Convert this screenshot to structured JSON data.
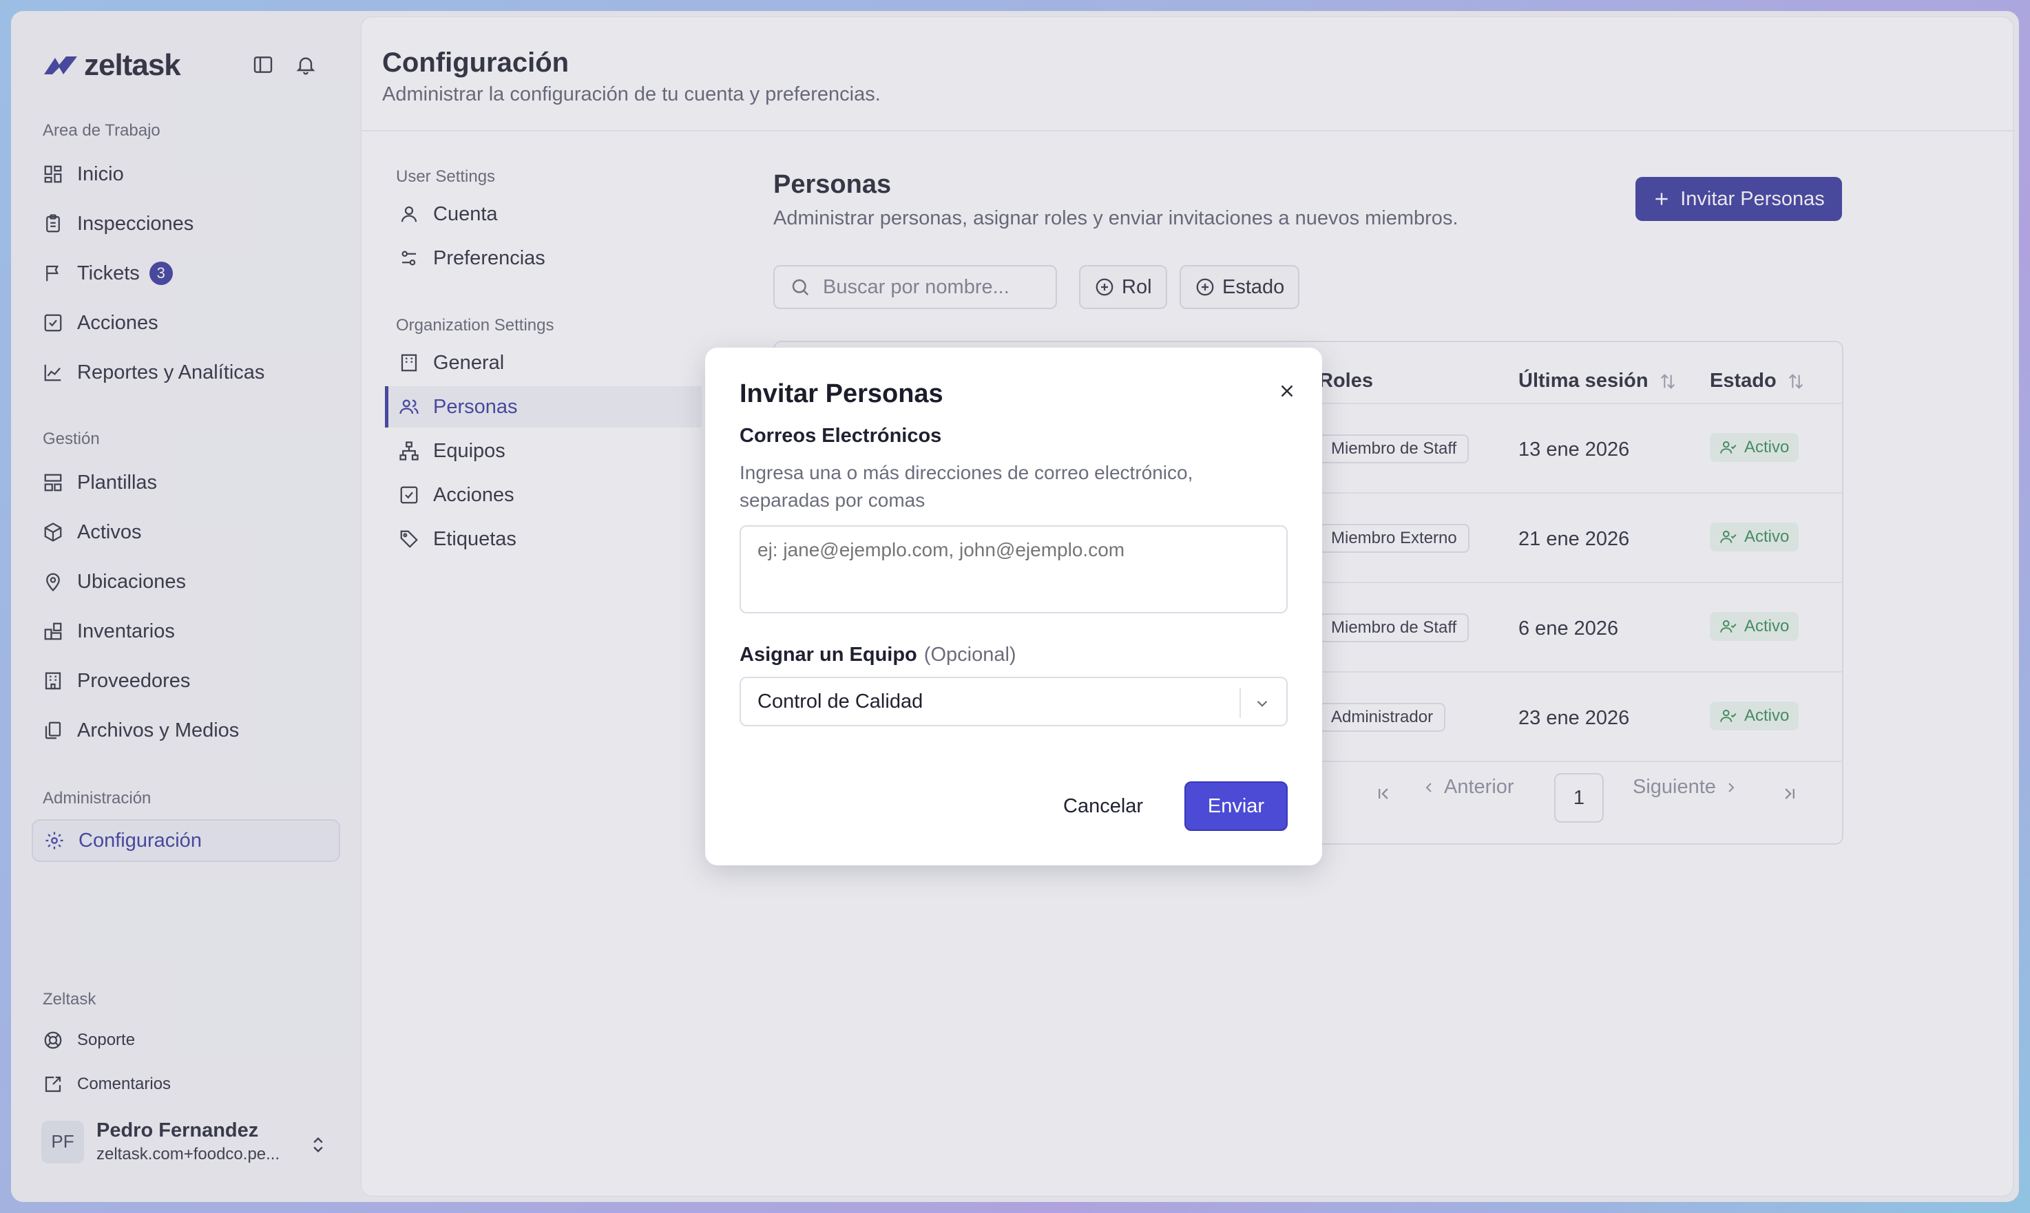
{
  "brand": {
    "name": "zeltask",
    "accent": "#33339a"
  },
  "sidebar": {
    "workspace_label": "Area de Trabajo",
    "workspace_items": [
      {
        "label": "Inicio",
        "icon": "grid-icon"
      },
      {
        "label": "Inspecciones",
        "icon": "clipboard-icon"
      },
      {
        "label": "Tickets",
        "icon": "flag-icon",
        "badge": "3"
      },
      {
        "label": "Acciones",
        "icon": "checkbox-icon"
      },
      {
        "label": "Reportes y Analíticas",
        "icon": "chart-icon"
      }
    ],
    "management_label": "Gestión",
    "management_items": [
      {
        "label": "Plantillas",
        "icon": "template-icon"
      },
      {
        "label": "Activos",
        "icon": "cube-icon"
      },
      {
        "label": "Ubicaciones",
        "icon": "map-pin-icon"
      },
      {
        "label": "Inventarios",
        "icon": "blocks-icon"
      },
      {
        "label": "Proveedores",
        "icon": "building-icon"
      },
      {
        "label": "Archivos y Medios",
        "icon": "files-icon"
      }
    ],
    "admin_label": "Administración",
    "admin_items": [
      {
        "label": "Configuración",
        "icon": "gear-icon",
        "active": true
      }
    ],
    "footer_label": "Zeltask",
    "footer_items": [
      {
        "label": "Soporte",
        "icon": "lifebuoy-icon"
      },
      {
        "label": "Comentarios",
        "icon": "feedback-icon"
      }
    ],
    "user": {
      "initials": "PF",
      "name": "Pedro Fernandez",
      "email": "zeltask.com+foodco.pe..."
    }
  },
  "header": {
    "title": "Configuración",
    "subtitle": "Administrar la configuración de tu cuenta y preferencias."
  },
  "settings_nav": {
    "user_label": "User Settings",
    "user_items": [
      {
        "label": "Cuenta",
        "icon": "user-icon"
      },
      {
        "label": "Preferencias",
        "icon": "sliders-icon"
      }
    ],
    "org_label": "Organization Settings",
    "org_items": [
      {
        "label": "General",
        "icon": "building-icon"
      },
      {
        "label": "Personas",
        "icon": "users-icon",
        "active": true
      },
      {
        "label": "Equipos",
        "icon": "org-chart-icon"
      },
      {
        "label": "Acciones",
        "icon": "checkbox-icon"
      },
      {
        "label": "Etiquetas",
        "icon": "tag-icon"
      }
    ]
  },
  "people": {
    "title": "Personas",
    "subtitle": "Administrar personas, asignar roles y enviar invitaciones a nuevos miembros.",
    "invite_label": "Invitar Personas",
    "search_placeholder": "Buscar por nombre...",
    "filters": [
      "Rol",
      "Estado"
    ],
    "columns": {
      "roles": "Roles",
      "last_session": "Última sesión",
      "status": "Estado"
    },
    "rows": [
      {
        "role": "Miembro de Staff",
        "last_session": "13 ene 2026",
        "status": "Activo"
      },
      {
        "role": "Miembro Externo",
        "last_session": "21 ene 2026",
        "status": "Activo"
      },
      {
        "role": "Miembro de Staff",
        "last_session": "6 ene 2026",
        "status": "Activo"
      },
      {
        "role": "Administrador",
        "last_session": "23 ene 2026",
        "status": "Activo"
      }
    ],
    "pager": {
      "prev": "Anterior",
      "next": "Siguiente",
      "page": "1"
    }
  },
  "modal": {
    "title": "Invitar Personas",
    "emails_label": "Correos Electrónicos",
    "emails_help": "Ingresa una o más direcciones de correo electrónico, separadas por comas",
    "emails_placeholder": "ej: jane@ejemplo.com, john@ejemplo.com",
    "emails_value": "",
    "team_label": "Asignar un Equipo",
    "team_optional": "(Opcional)",
    "team_value": "Control de Calidad",
    "cancel_label": "Cancelar",
    "send_label": "Enviar"
  }
}
